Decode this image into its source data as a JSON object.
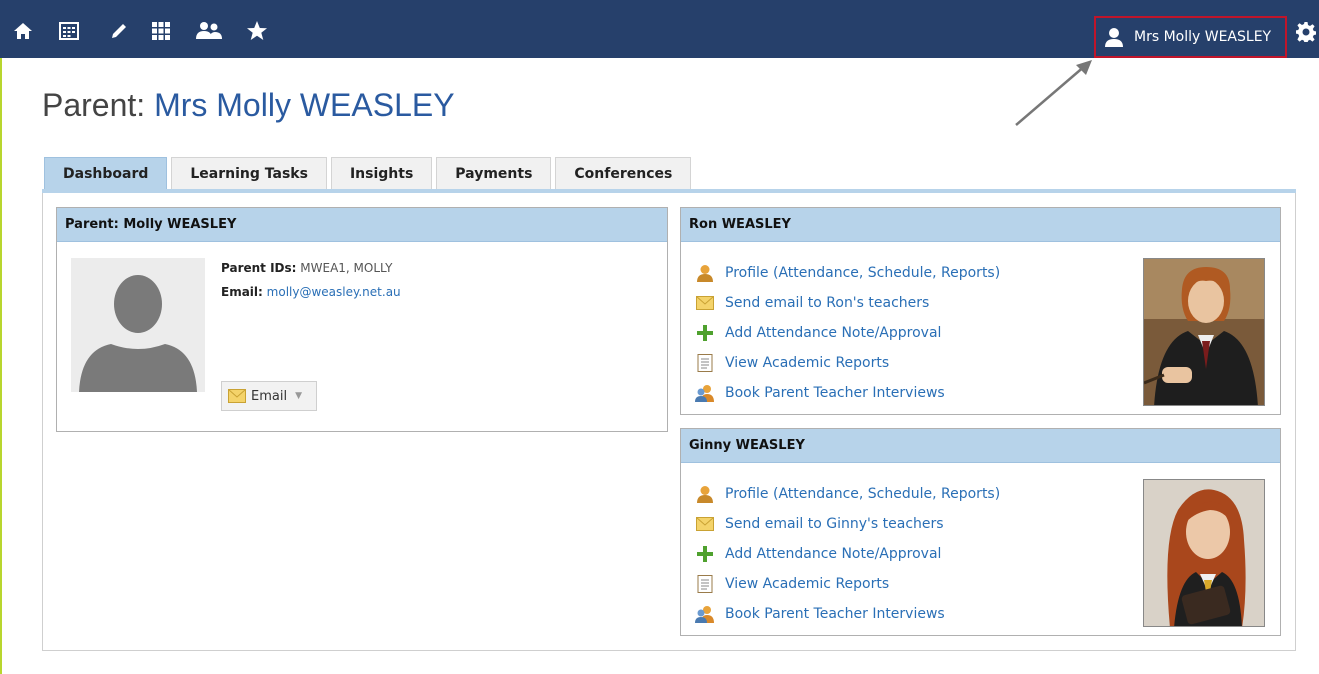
{
  "topbar": {
    "icons": [
      "home-icon",
      "calendar-icon",
      "pencil-icon",
      "grid-icon",
      "people-icon",
      "star-icon"
    ],
    "user_label": "Mrs Molly WEASLEY",
    "settings_icon": "gear-icon"
  },
  "page": {
    "title_prefix": "Parent: ",
    "title_name": "Mrs Molly WEASLEY"
  },
  "tabs": [
    {
      "label": "Dashboard",
      "active": true
    },
    {
      "label": "Learning Tasks"
    },
    {
      "label": "Insights"
    },
    {
      "label": "Payments"
    },
    {
      "label": "Conferences"
    }
  ],
  "parent_panel": {
    "title": "Parent: Molly WEASLEY",
    "ids_label": "Parent IDs:",
    "ids_value": "MWEA1, MOLLY",
    "email_label": "Email:",
    "email_value": "molly@weasley.net.au",
    "email_button": "Email"
  },
  "students": [
    {
      "name": "Ron WEASLEY",
      "links": [
        "Profile (Attendance, Schedule, Reports)",
        "Send email to Ron's teachers",
        "Add Attendance Note/Approval",
        "View Academic Reports",
        "Book Parent Teacher Interviews"
      ]
    },
    {
      "name": "Ginny WEASLEY",
      "links": [
        "Profile (Attendance, Schedule, Reports)",
        "Send email to Ginny's teachers",
        "Add Attendance Note/Approval",
        "View Academic Reports",
        "Book Parent Teacher Interviews"
      ]
    }
  ],
  "colors": {
    "topbar": "#26406b",
    "accent_blue": "#2a5aa0",
    "panel_header": "#b7d3ea",
    "highlight_red": "#c0152a"
  }
}
